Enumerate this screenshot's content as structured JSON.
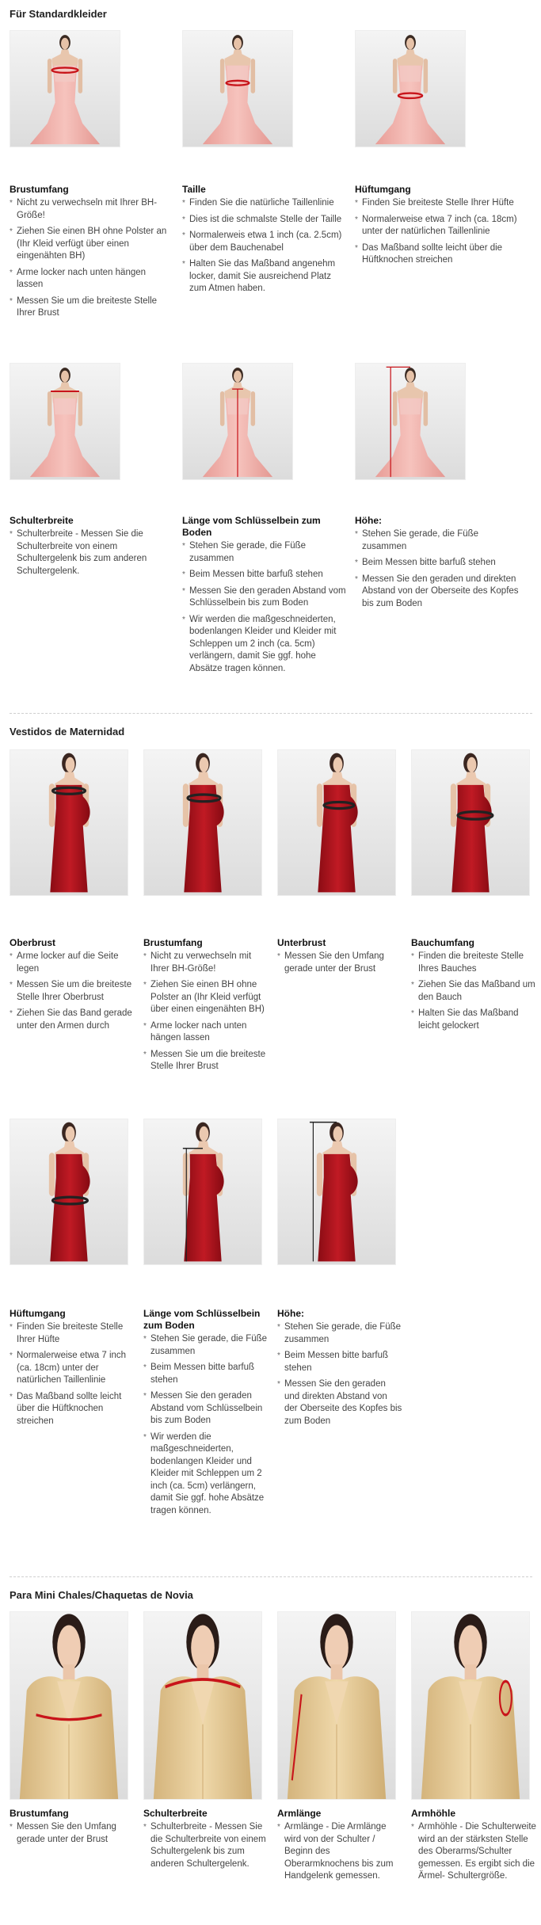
{
  "sections": [
    {
      "title": "Für Standardkleider",
      "items": [
        {
          "title": "Brustumfang",
          "bullets": [
            "Nicht zu verwechseln mit Ihrer BH-Größe!",
            "Ziehen Sie einen BH ohne Polster an (Ihr Kleid verfügt über einen eingenähten BH)",
            "Arme locker nach unten hängen lassen",
            "Messen Sie um die breiteste Stelle Ihrer Brust"
          ]
        },
        {
          "title": "Taille",
          "bullets": [
            "Finden Sie die natürliche Taillenlinie",
            "Dies ist die schmalste Stelle der Taille",
            "Normalerweis etwa 1 inch (ca. 2.5cm) über dem Bauchenabel",
            "Halten Sie das Maßband angenehm locker, damit Sie ausreichend Platz zum Atmen haben."
          ]
        },
        {
          "title": "Hüftumgang",
          "bullets": [
            "Finden Sie breiteste Stelle Ihrer Hüfte",
            "Normalerweise etwa 7 inch (ca. 18cm) unter der natürlichen Taillenlinie",
            "Das Maßband sollte leicht über die Hüftknochen streichen"
          ]
        },
        {
          "title": "Schulterbreite",
          "bullets": [
            "Schulterbreite - Messen Sie die Schulterbreite von einem Schultergelenk bis zum anderen Schultergelenk."
          ]
        },
        {
          "title": "Länge vom Schlüsselbein zum Boden",
          "bullets": [
            "Stehen Sie gerade, die Füße zusammen",
            "Beim Messen bitte barfuß stehen",
            "Messen Sie den geraden Abstand vom Schlüsselbein bis zum Boden",
            "Wir werden die maßgeschneiderten, bodenlangen Kleider und Kleider mit Schleppen um 2 inch (ca. 5cm) verlängern, damit Sie ggf. hohe Absätze tragen können."
          ]
        },
        {
          "title": "Höhe:",
          "bullets": [
            "Stehen Sie gerade, die Füße zusammen",
            "Beim Messen bitte barfuß stehen",
            "Messen Sie den geraden und direkten Abstand von der Oberseite des Kopfes bis zum Boden"
          ]
        }
      ]
    },
    {
      "title": "Vestidos de Maternidad",
      "items": [
        {
          "title": "Oberbrust",
          "bullets": [
            "Arme locker auf die Seite legen",
            "Messen Sie um die breiteste Stelle Ihrer Oberbrust",
            "Ziehen Sie das Band gerade unter den Armen durch"
          ]
        },
        {
          "title": "Brustumfang",
          "bullets": [
            "Nicht zu verwechseln mit Ihrer BH-Größe!",
            "Ziehen Sie einen BH ohne Polster an (Ihr Kleid verfügt über einen eingenähten BH)",
            "Arme locker nach unten hängen lassen",
            "Messen Sie um die breiteste Stelle Ihrer Brust"
          ]
        },
        {
          "title": "Unterbrust",
          "bullets": [
            "Messen Sie den Umfang gerade unter der Brust"
          ]
        },
        {
          "title": "Bauchumfang",
          "bullets": [
            "Finden die breiteste Stelle Ihres Bauches",
            "Ziehen Sie das Maßband um den Bauch",
            "Halten Sie das Maßband leicht gelockert"
          ]
        },
        {
          "title": "Hüftumgang",
          "bullets": [
            "Finden Sie breiteste Stelle Ihrer Hüfte",
            "Normalerweise etwa 7 inch (ca. 18cm) unter der natürlichen Taillenlinie",
            "Das Maßband sollte leicht über die Hüftknochen streichen"
          ]
        },
        {
          "title": "Länge vom Schlüsselbein zum Boden",
          "bullets": [
            "Stehen Sie gerade, die Füße zusammen",
            "Beim Messen bitte barfuß stehen",
            "Messen Sie den geraden Abstand vom Schlüsselbein bis zum Boden",
            "Wir werden die maßgeschneiderten, bodenlangen Kleider und Kleider mit Schleppen um 2 inch (ca. 5cm) verlängern, damit Sie ggf. hohe Absätze tragen können."
          ]
        },
        {
          "title": "Höhe:",
          "bullets": [
            "Stehen Sie gerade, die Füße zusammen",
            "Beim Messen bitte barfuß stehen",
            "Messen Sie den geraden und direkten Abstand von der Oberseite des Kopfes bis zum Boden"
          ]
        }
      ]
    },
    {
      "title": "Para Mini Chales/Chaquetas de Novia",
      "items": [
        {
          "title": "Brustumfang",
          "bullets": [
            "Messen Sie den Umfang gerade unter der Brust"
          ]
        },
        {
          "title": "Schulterbreite",
          "bullets": [
            "Schulterbreite - Messen Sie die Schulterbreite von einem Schultergelenk bis zum anderen Schultergelenk."
          ]
        },
        {
          "title": "Armlänge",
          "bullets": [
            "Armlänge - Die Armlänge wird von der Schulter / Beginn des Oberarmknochens bis zum Handgelenk gemessen."
          ]
        },
        {
          "title": "Armhöhle",
          "bullets": [
            "Armhöhle - Die Schulterweite wird an der stärksten Stelle des Oberarms/Schulter gemessen. Es ergibt sich die Ärmel- Schultergröße."
          ]
        }
      ]
    }
  ],
  "colors": {
    "pink_dress": "#f0b2ac",
    "red_dress": "#b0121c",
    "gold_jacket": "#e3c996",
    "tape": "#c8141a",
    "divider": "#cfcfcf"
  }
}
